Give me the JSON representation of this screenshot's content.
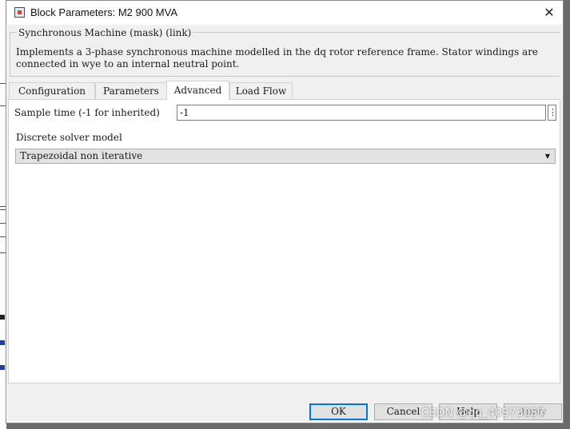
{
  "window": {
    "title": "Block Parameters: M2 900 MVA",
    "icon": "block-parameters-icon",
    "close_icon": "close-icon",
    "close_glyph": "✕"
  },
  "mask": {
    "title": "Synchronous Machine (mask) (link)",
    "description": "Implements a 3-phase synchronous machine modelled in the dq rotor reference frame. Stator windings are connected in wye to an internal neutral point."
  },
  "tabs": [
    {
      "label": "Configuration",
      "active": false
    },
    {
      "label": "Parameters",
      "active": false
    },
    {
      "label": "Advanced",
      "active": true
    },
    {
      "label": "Load Flow",
      "active": false
    }
  ],
  "advanced": {
    "sample_time_label": "Sample time (-1 for inherited)",
    "sample_time_value": "-1",
    "more_glyph": "⋮",
    "solver_label": "Discrete solver model",
    "solver_value": "Trapezoidal non iterative",
    "solver_caret": "▼"
  },
  "buttons": {
    "ok": "OK",
    "cancel": "Cancel",
    "help": "Help",
    "apply": "Apply"
  },
  "watermark": "CSDN @qq_40973057",
  "colors": {
    "accent": "#0078d7",
    "dialog_bg": "#f0f0f0"
  }
}
